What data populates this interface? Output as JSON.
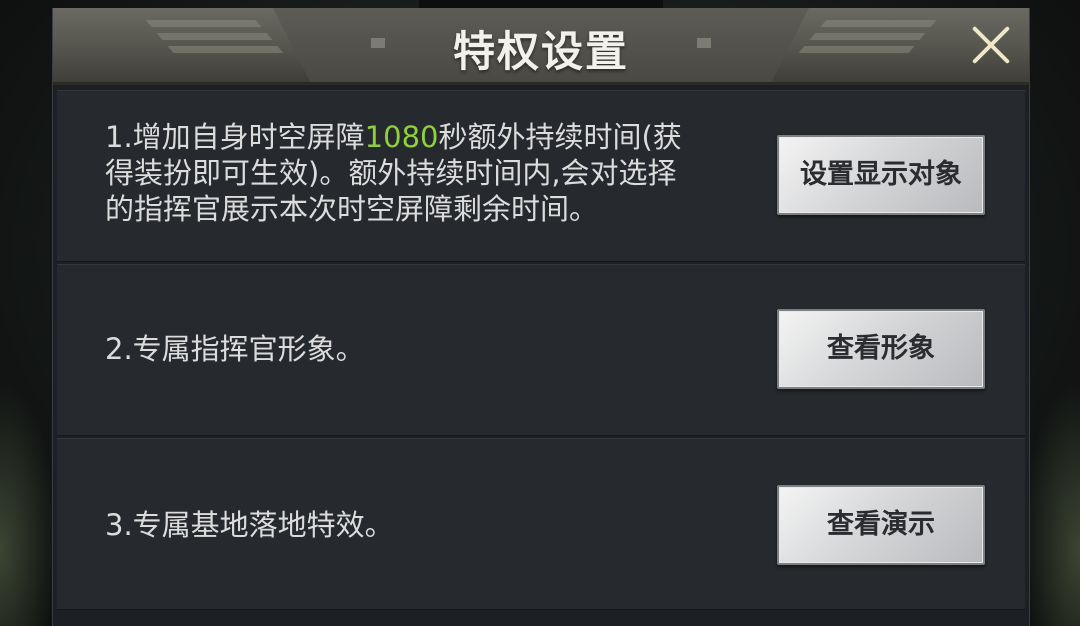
{
  "dialog": {
    "title": "特权设置",
    "close_icon": "close-icon"
  },
  "colors": {
    "highlight": "#8fd13b",
    "header": "#55544d",
    "row_bg": "#26292e"
  },
  "privileges": [
    {
      "text_prefix": "1.增加自身时空屏障",
      "text_highlight": "1080",
      "text_line1_rest": "秒额外持续时间(获",
      "text_line2": "得装扮即可生效)。额外持续时间内,会对选择",
      "text_line3": "的指挥官展示本次时空屏障剩余时间。",
      "button": "设置显示对象"
    },
    {
      "text": "2.专属指挥官形象。",
      "button": "查看形象"
    },
    {
      "text": "3.专属基地落地特效。",
      "button": "查看演示"
    }
  ]
}
